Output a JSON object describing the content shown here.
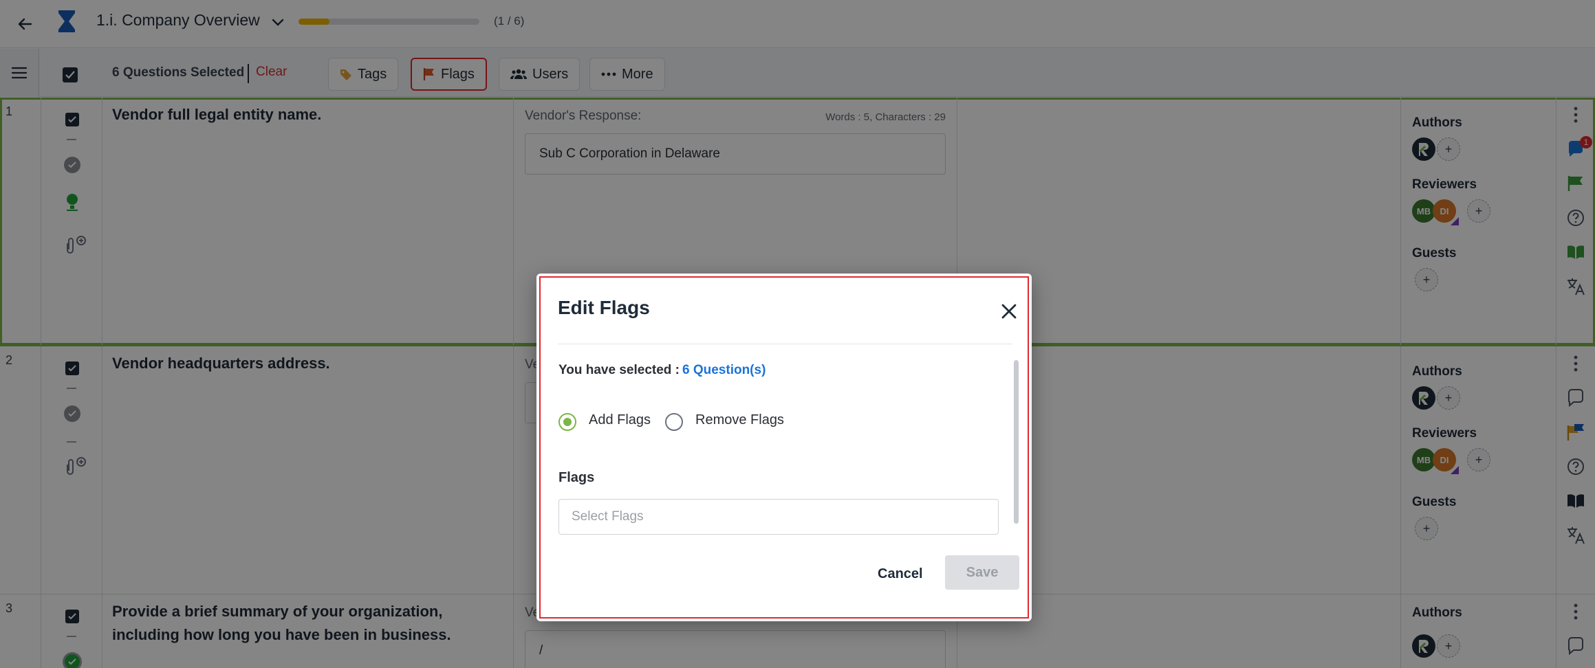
{
  "header": {
    "title": "1.i. Company Overview",
    "progress_count": "(1 / 6)",
    "progress_fraction": 0.17
  },
  "toolbar": {
    "selected_text": "6 Questions Selected",
    "clear_label": "Clear",
    "buttons": [
      {
        "label": "Tags",
        "icon": "tag-icon"
      },
      {
        "label": "Flags",
        "icon": "flag-icon"
      },
      {
        "label": "Users",
        "icon": "users-icon"
      },
      {
        "label": "More",
        "icon": "more-icon"
      }
    ]
  },
  "rows": [
    {
      "num": "1",
      "question": "Vendor full legal entity name.",
      "response_label": "Vendor's Response:",
      "response_meta": "Words : 5, Characters : 29",
      "response_value": "Sub C Corporation in Delaware",
      "authors_label": "Authors",
      "reviewers_label": "Reviewers",
      "guests_label": "Guests",
      "reviewer_initials": [
        "MB",
        "DI"
      ],
      "comment_badge": "1"
    },
    {
      "num": "2",
      "question": "Vendor headquarters address.",
      "response_label": "Ve",
      "authors_label": "Authors",
      "reviewers_label": "Reviewers",
      "guests_label": "Guests",
      "reviewer_initials": [
        "MB",
        "DI"
      ]
    },
    {
      "num": "3",
      "question": "Provide a brief summary of your organization, including how long you have been in business.",
      "response_label": "Ve",
      "response_value": "/",
      "authors_label": "Authors"
    }
  ],
  "modal": {
    "title": "Edit Flags",
    "selected_prefix": "You have selected :",
    "selected_link": "6 Question(s)",
    "option_add": "Add Flags",
    "option_remove": "Remove Flags",
    "selected_option": "Add Flags",
    "flags_label": "Flags",
    "flags_placeholder": "Select Flags",
    "cancel_label": "Cancel",
    "save_label": "Save"
  },
  "colors": {
    "accent_green": "#7ab648",
    "link_blue": "#1a73d9",
    "clear_red": "#d0332b",
    "progress_yellow": "#f0b400"
  }
}
